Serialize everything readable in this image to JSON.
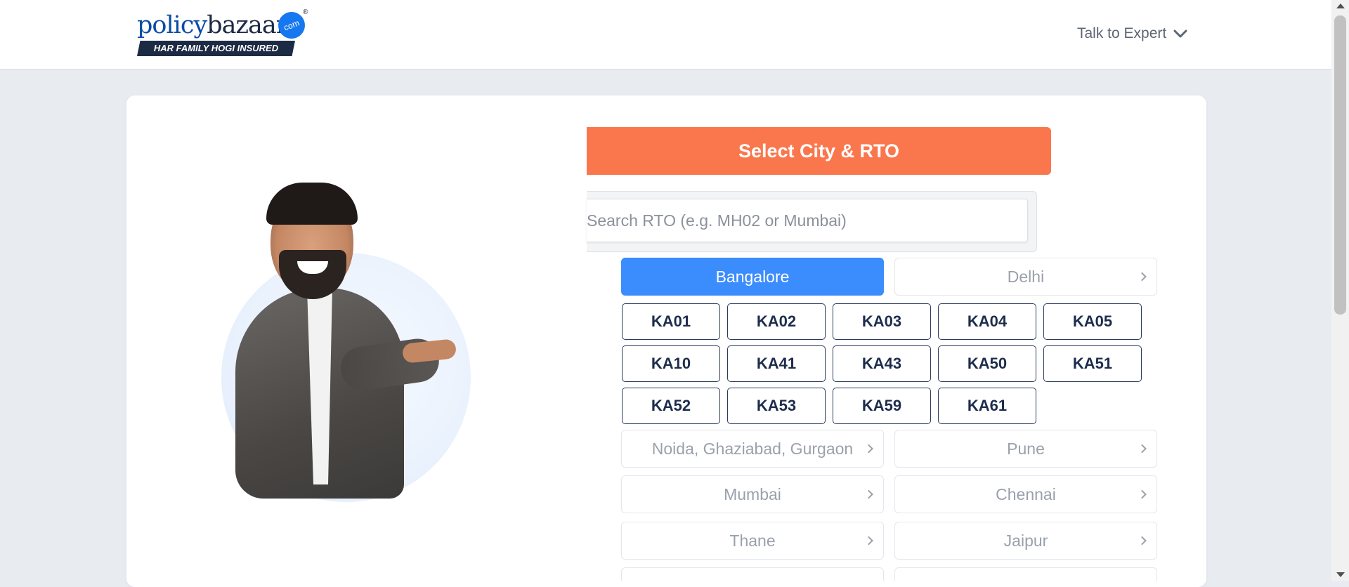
{
  "header": {
    "logo": {
      "word_left": "policy",
      "word_right": "bazaar",
      "com_badge": "com",
      "registered": "®",
      "tagline": "HAR FAMILY HOGI INSURED"
    },
    "talk_to_expert": "Talk to Expert"
  },
  "rto": {
    "title": "Select City & RTO",
    "search_placeholder": "Search RTO (e.g. MH02 or Mumbai)",
    "selected_city": "Bangalore",
    "cities": [
      "Bangalore",
      "Delhi",
      "Noida, Ghaziabad, Gurgaon",
      "Pune",
      "Mumbai",
      "Chennai",
      "Thane",
      "Jaipur"
    ],
    "rto_codes": [
      "KA01",
      "KA02",
      "KA03",
      "KA04",
      "KA05",
      "KA10",
      "KA41",
      "KA43",
      "KA50",
      "KA51",
      "KA52",
      "KA53",
      "KA59",
      "KA61"
    ]
  },
  "colors": {
    "accent_orange": "#fa774d",
    "selected_blue": "#3b8cfd",
    "rto_border": "#2a3b5c"
  }
}
